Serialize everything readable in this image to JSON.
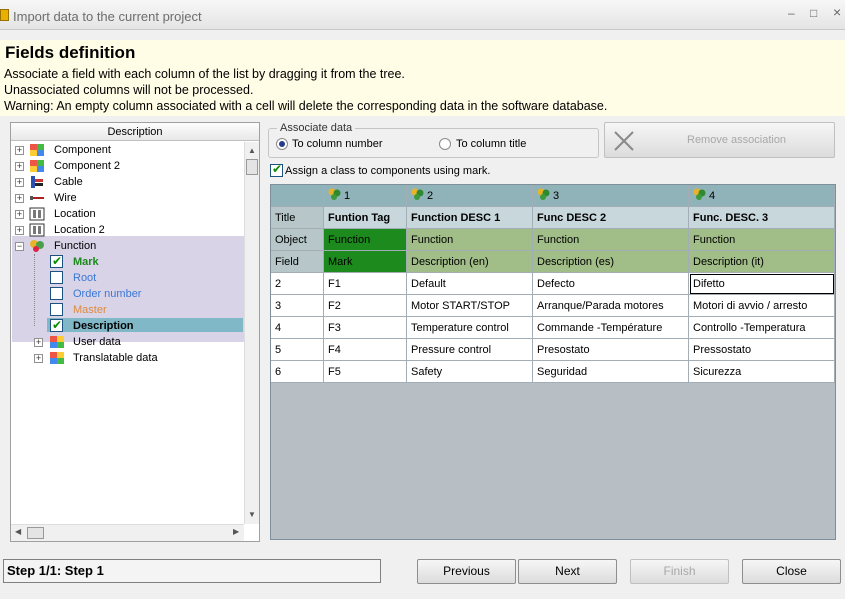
{
  "window": {
    "title": "Import data to the current project",
    "min_glyph": "–",
    "max_glyph": "□",
    "close_glyph": "×"
  },
  "header": {
    "heading": "Fields definition",
    "line1": "Associate a field with each column of the list by dragging it from the tree.",
    "line2": "Unassociated columns will not be processed.",
    "line3": "Warning: An empty column associated with a cell will delete the corresponding data in the software database."
  },
  "tree": {
    "header": "Description",
    "items": [
      {
        "label": "Component",
        "icon": "component-icon"
      },
      {
        "label": "Component 2",
        "icon": "component-icon"
      },
      {
        "label": "Cable",
        "icon": "cable-icon"
      },
      {
        "label": "Wire",
        "icon": "wire-icon"
      },
      {
        "label": "Location",
        "icon": "location-icon"
      },
      {
        "label": "Location 2",
        "icon": "location-icon"
      },
      {
        "label": "Function",
        "icon": "function-icon"
      }
    ],
    "function_children": [
      {
        "label": "Mark",
        "checked": true,
        "color": "#1a8a1a"
      },
      {
        "label": "Root",
        "checked": false,
        "color": "#3a78d6"
      },
      {
        "label": "Order number",
        "checked": false,
        "color": "#3a78d6"
      },
      {
        "label": "Master",
        "checked": false,
        "color": "#e08a3a"
      },
      {
        "label": "Description",
        "checked": true,
        "color": "#000000"
      }
    ],
    "more_items": [
      {
        "label": "User data",
        "icon": "user-data-icon"
      },
      {
        "label": "Translatable data",
        "icon": "translatable-data-icon"
      }
    ]
  },
  "associate": {
    "legend": "Associate data",
    "option_number": "To column number",
    "option_title": "To column title",
    "selected": "To column number",
    "remove_button": "Remove association",
    "assign_class_label": "Assign a class to components using mark.",
    "assign_class_checked": true
  },
  "grid": {
    "row_labels": {
      "title": "Title",
      "object": "Object",
      "field": "Field"
    },
    "columns": [
      {
        "num": "1",
        "title": "Funtion Tag",
        "object": "Function",
        "field": "Mark"
      },
      {
        "num": "2",
        "title": "Function DESC 1",
        "object": "Function",
        "field": "Description (en)"
      },
      {
        "num": "3",
        "title": "Func DESC 2",
        "object": "Function",
        "field": "Description (es)"
      },
      {
        "num": "4",
        "title": "Func. DESC. 3",
        "object": "Function",
        "field": "Description (it)"
      }
    ],
    "rows": [
      {
        "n": "2",
        "cells": [
          "F1",
          "Default",
          "Defecto",
          "Difetto"
        ]
      },
      {
        "n": "3",
        "cells": [
          "F2",
          "Motor START/STOP",
          "Arranque/Parada motores",
          "Motori di avvio / arresto"
        ]
      },
      {
        "n": "4",
        "cells": [
          "F3",
          "Temperature control",
          "Commande -Température",
          "Controllo -Temperatura"
        ]
      },
      {
        "n": "5",
        "cells": [
          "F4",
          "Pressure control",
          "Presostato",
          "Pressostato"
        ]
      },
      {
        "n": "6",
        "cells": [
          "F5",
          "Safety",
          "Seguridad",
          "Sicurezza"
        ]
      }
    ]
  },
  "footer": {
    "status": "Step 1/1: Step 1",
    "previous": "Previous",
    "next": "Next",
    "finish": "Finish",
    "close": "Close"
  }
}
